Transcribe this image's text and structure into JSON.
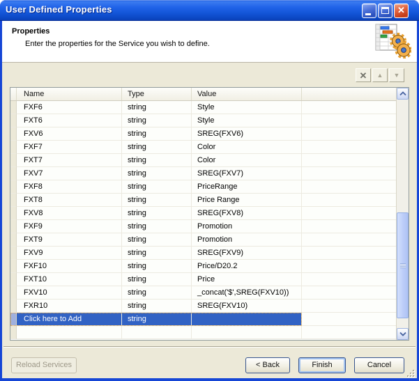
{
  "window": {
    "title": "User Defined Properties"
  },
  "icons": {
    "delete": "✕",
    "move_up": "▲",
    "move_down": "▼",
    "close": "✕"
  },
  "header": {
    "title": "Properties",
    "subtitle": "Enter the properties for the Service you wish to define."
  },
  "table": {
    "columns": [
      "Name",
      "Type",
      "Value",
      ""
    ],
    "rows": [
      {
        "name": "FXF6",
        "type": "string",
        "value": "Style"
      },
      {
        "name": "FXT6",
        "type": "string",
        "value": "Style"
      },
      {
        "name": "FXV6",
        "type": "string",
        "value": "SREG(FXV6)"
      },
      {
        "name": "FXF7",
        "type": "string",
        "value": "Color"
      },
      {
        "name": "FXT7",
        "type": "string",
        "value": "Color"
      },
      {
        "name": "FXV7",
        "type": "string",
        "value": "SREG(FXV7)"
      },
      {
        "name": "FXF8",
        "type": "string",
        "value": "PriceRange"
      },
      {
        "name": "FXT8",
        "type": "string",
        "value": "Price Range"
      },
      {
        "name": "FXV8",
        "type": "string",
        "value": "SREG(FXV8)"
      },
      {
        "name": "FXF9",
        "type": "string",
        "value": "Promotion"
      },
      {
        "name": "FXT9",
        "type": "string",
        "value": "Promotion"
      },
      {
        "name": "FXV9",
        "type": "string",
        "value": "SREG(FXV9)"
      },
      {
        "name": "FXF10",
        "type": "string",
        "value": "Price/D20.2"
      },
      {
        "name": "FXT10",
        "type": "string",
        "value": "Price"
      },
      {
        "name": "FXV10",
        "type": "string",
        "value": "_concat('$',SREG(FXV10))"
      },
      {
        "name": "FXR10",
        "type": "string",
        "value": "SREG(FXV10)"
      }
    ],
    "add_row": {
      "name": "Click here to Add",
      "type": "string",
      "value": ""
    }
  },
  "colors": {
    "selection": "#3162C4",
    "selection_margin": "#9FB0DE",
    "titlebar": "#1254D6",
    "dialog_bg": "#ECE9D8"
  },
  "footer": {
    "reload_label": "Reload Services",
    "back_label": "< Back",
    "finish_label": "Finish",
    "cancel_label": "Cancel"
  }
}
